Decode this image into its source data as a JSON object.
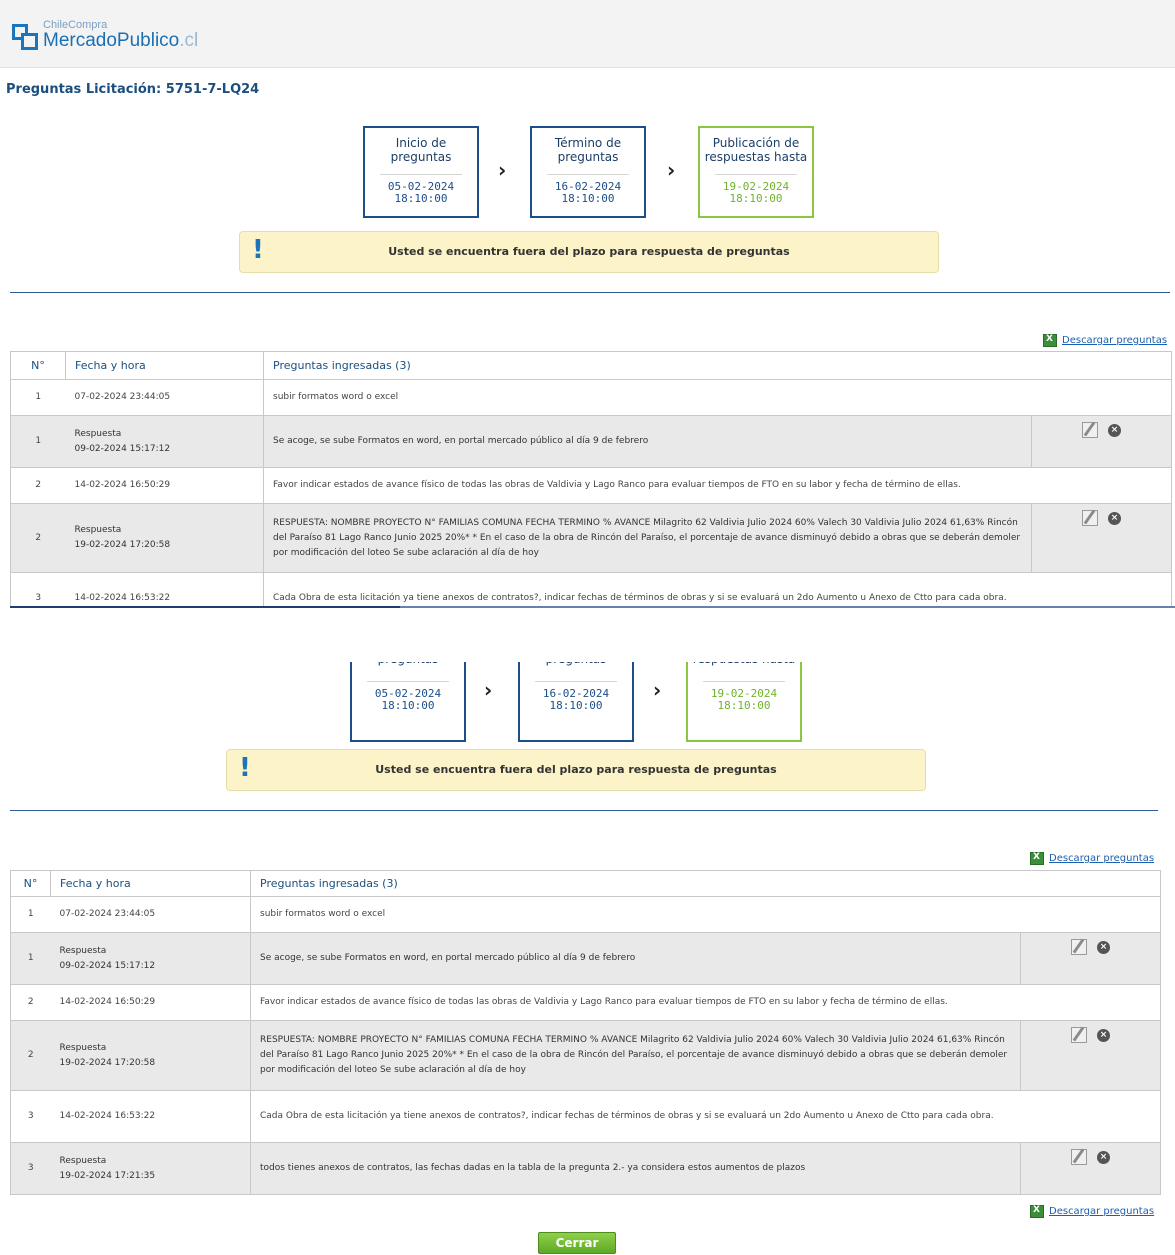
{
  "header": {
    "logo_small": "ChileCompra",
    "logo_main": "MercadoPublico",
    "logo_suffix": ".cl"
  },
  "title": "Preguntas Licitación: 5751-7-LQ24",
  "stages": [
    {
      "label": "Inicio de preguntas",
      "date": "05-02-2024",
      "time": "18:10:00"
    },
    {
      "label": "Término de preguntas",
      "date": "16-02-2024",
      "time": "18:10:00"
    },
    {
      "label": "Publicación de respuestas hasta",
      "date": "19-02-2024",
      "time": "18:10:00"
    }
  ],
  "stages_cropped": [
    {
      "label": "preguntas"
    },
    {
      "label": "preguntas"
    },
    {
      "label": "respuestas hasta"
    }
  ],
  "warning": "Usted se encuentra fuera del plazo para respuesta de preguntas",
  "download_label": "Descargar preguntas",
  "table": {
    "headers": {
      "n": "N°",
      "fecha": "Fecha y hora",
      "preguntas": "Preguntas ingresadas (3)"
    },
    "rows": [
      {
        "n": "1",
        "fecha": "07-02-2024 23:44:05",
        "text": "subir formatos word o excel"
      },
      {
        "n": "1",
        "tipo": "Respuesta",
        "fecha": "09-02-2024 15:17:12",
        "text": "Se acoge, se sube Formatos en word, en portal mercado público al día 9 de febrero"
      },
      {
        "n": "2",
        "fecha": "14-02-2024 16:50:29",
        "text": "Favor indicar estados de avance físico de todas las obras de Valdivia y Lago Ranco para evaluar tiempos de FTO en su labor y fecha de término de ellas."
      },
      {
        "n": "2",
        "tipo": "Respuesta",
        "fecha": "19-02-2024 17:20:58",
        "text": "RESPUESTA: NOMBRE PROYECTO N° FAMILIAS COMUNA FECHA TERMINO % AVANCE Milagrito 62 Valdivia Julio 2024 60% Valech 30 Valdivia Julio 2024 61,63% Rincón del Paraíso 81 Lago Ranco Junio 2025 20%* * En el caso de la obra de Rincón del Paraíso, el porcentaje de avance disminuyó debido a obras que se deberán demoler por modificación del loteo Se sube aclaración al día de hoy"
      },
      {
        "n": "3",
        "fecha": "14-02-2024 16:53:22",
        "text": "Cada Obra de esta licitación ya tiene anexos de contratos?, indicar fechas de términos de obras y si se evaluará un 2do Aumento u Anexo de Ctto para cada obra."
      },
      {
        "n": "3",
        "tipo": "Respuesta",
        "fecha": "19-02-2024 17:21:35",
        "text": "todos tienes anexos de contratos, las fechas dadas en la tabla de la pregunta 2.- ya considera estos aumentos de plazos"
      }
    ]
  },
  "close_label": "Cerrar",
  "colors": {
    "navy": "#1c4e8a",
    "green": "#8cc63f",
    "warn_bg": "#fcf3c8",
    "answer_bg": "#e9e9e9"
  }
}
